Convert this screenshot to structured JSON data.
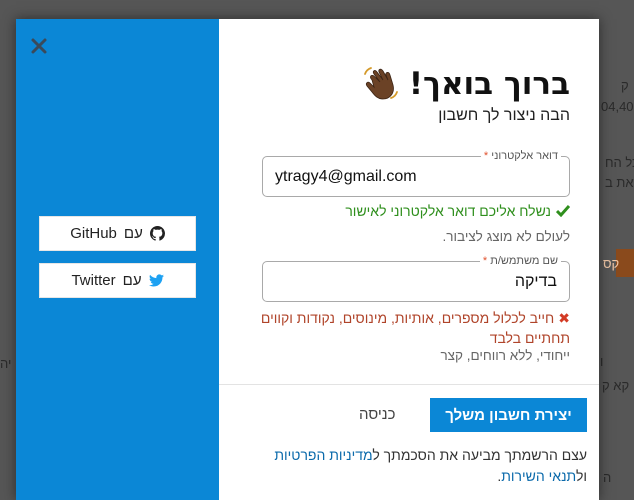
{
  "background": {
    "fragments": [
      "ק",
      "04,40",
      "כל הח",
      "ראת ב",
      "קס",
      "יה",
      "ו",
      "קא ק",
      "ה"
    ]
  },
  "modal": {
    "close_icon": "close-icon",
    "social": {
      "github": {
        "prefix": "עם",
        "brand": "GitHub",
        "icon": "github-icon"
      },
      "twitter": {
        "prefix": "עם",
        "brand": "Twitter",
        "icon": "twitter-icon"
      }
    },
    "title": "ברוך בואך!",
    "wave_icon": "waving-hand-icon",
    "subtitle": "הבה ניצור לך חשבון",
    "email": {
      "label": "דואר אלקטרוני",
      "required_mark": "*",
      "value": "ytragy4@gmail.com",
      "success_message": "נשלח אליכם דואר אלקטרוני לאישור",
      "hint": "לעולם לא מוצג לציבור."
    },
    "username": {
      "label": "שם משתמש/ת",
      "required_mark": "*",
      "value": "בדיקה",
      "error_message": "חייב לכלול מספרים, אותיות, מינוסים, נקודות וקווים תחתיים בלבד",
      "hint": "ייחודי, ללא רווחים, קצר"
    },
    "create_button": "יצירת חשבון משלך",
    "login_link": "כניסה",
    "footer": {
      "before": "עצם הרשמתך מביעה את הסכמתך ל",
      "privacy_link": "מדיניות הפרטיות",
      "conjunction": " ול",
      "terms_link": "תנאי השירות",
      "after": "."
    }
  },
  "colors": {
    "accent": "#0b87d6",
    "success": "#2f8f1d",
    "error": "#d33b25"
  }
}
